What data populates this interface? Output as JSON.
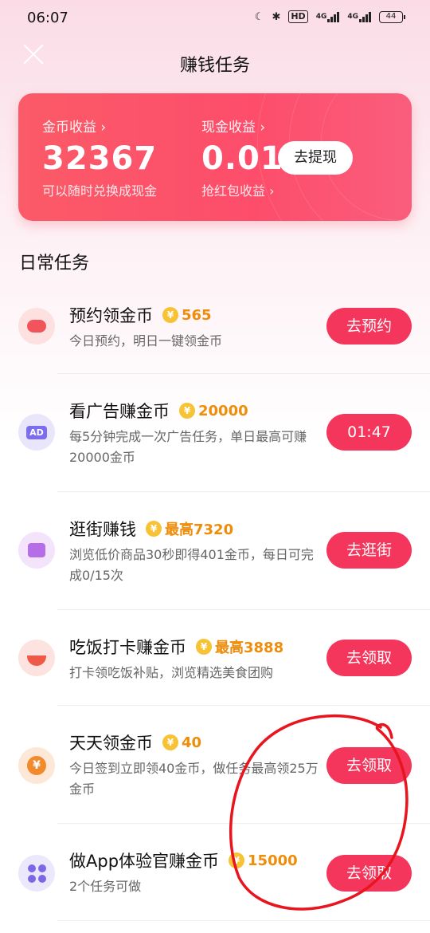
{
  "status_bar": {
    "time": "06:07",
    "hd": "HD",
    "net1": "4G",
    "net2": "4G",
    "battery": "44"
  },
  "header": {
    "title": "赚钱任务"
  },
  "earnings": {
    "coins_label": "金币收益 ›",
    "coins_value": "32367",
    "coins_sub": "可以随时兑换成现金",
    "cash_label": "现金收益 ›",
    "cash_value": "0.01",
    "cash_sub": "抢红包收益 ›",
    "withdraw_label": "去提现"
  },
  "section_title": "日常任务",
  "tasks": [
    {
      "name": "预约领金币",
      "reward": "565",
      "desc": "今日预约，明日一键领金币",
      "button": "去预约",
      "icon": "piggy-bank-icon",
      "icon_bg": "#fde0e0",
      "icon_color": "#f2545b"
    },
    {
      "name": "看广告赚金币",
      "reward": "20000",
      "desc": "每5分钟完成一次广告任务，单日最高可赚20000金币",
      "button": "01:47",
      "icon": "ad-icon",
      "icon_text": "AD",
      "icon_bg": "#e9e6fb",
      "icon_color": "#7b6cf0"
    },
    {
      "name": "逛街赚钱",
      "reward": "最高7320",
      "desc": "浏览低价商品30秒即得401金币，每日可完成0/15次",
      "button": "去逛街",
      "icon": "shop-icon",
      "icon_bg": "#f3e3fb",
      "icon_color": "#b66ee8"
    },
    {
      "name": "吃饭打卡赚金币",
      "reward": "最高3888",
      "desc": "打卡领吃饭补贴，浏览精选美食团购",
      "button": "去领取",
      "icon": "bowl-icon",
      "icon_bg": "#fde3e0",
      "icon_color": "#ef5a48"
    },
    {
      "name": "天天领金币",
      "reward": "40",
      "desc": "今日签到立即领40金币，做任务最高领25万金币",
      "button": "去领取",
      "icon": "coin-icon",
      "icon_bg": "#fde8d7",
      "icon_color": "#f08a2c"
    },
    {
      "name": "做App体验官赚金币",
      "reward": "15000",
      "desc": "2个任务可做",
      "button": "去领取",
      "icon": "apps-icon",
      "icon_bg": "#ece8fb",
      "icon_color": "#7d67e6"
    }
  ],
  "colors": {
    "accent": "#f5365c",
    "reward": "#ef8d0b",
    "annotation": "#e8141e"
  }
}
